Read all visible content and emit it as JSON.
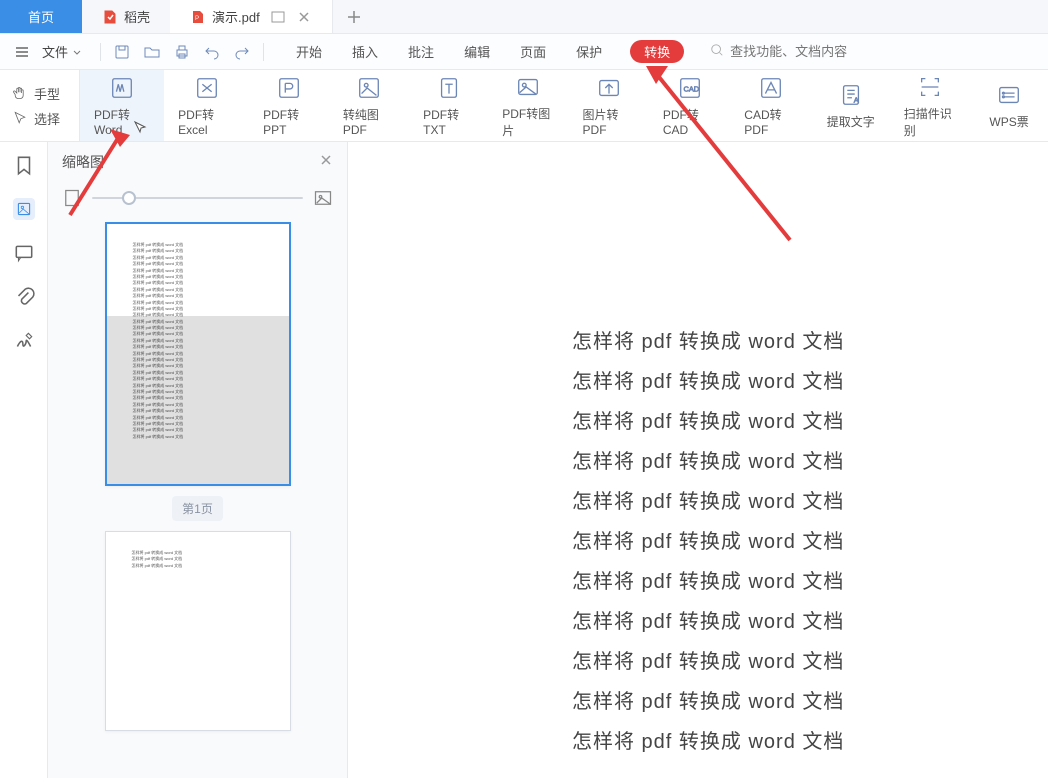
{
  "tabs": {
    "home": "首页",
    "docell": "稻壳",
    "active": "演示.pdf"
  },
  "menubar": {
    "file": "文件",
    "tabs": [
      "开始",
      "插入",
      "批注",
      "编辑",
      "页面",
      "保护",
      "转换"
    ],
    "search_placeholder": "查找功能、文档内容"
  },
  "ribbon_left": {
    "hand": "手型",
    "select": "选择"
  },
  "ribbon_tools": [
    "PDF转Word",
    "PDF转Excel",
    "PDF转PPT",
    "转纯图PDF",
    "PDF转TXT",
    "PDF转图片",
    "图片转PDF",
    "PDF转CAD",
    "CAD转PDF",
    "提取文字",
    "扫描件识别",
    "WPS票"
  ],
  "thumbnail": {
    "title": "缩略图",
    "page1_label": "第1页"
  },
  "doc_lines": [
    "怎样将 pdf 转换成 word 文档",
    "怎样将 pdf 转换成 word 文档",
    "怎样将 pdf 转换成 word 文档",
    "怎样将 pdf 转换成 word 文档",
    "怎样将 pdf 转换成 word 文档",
    "怎样将 pdf 转换成 word 文档",
    "怎样将 pdf 转换成 word 文档",
    "怎样将 pdf 转换成 word 文档",
    "怎样将 pdf 转换成 word 文档",
    "怎样将 pdf 转换成 word 文档",
    "怎样将 pdf 转换成 word 文档"
  ],
  "preview_line": "怎样将 pdf 转换成 word 文档"
}
